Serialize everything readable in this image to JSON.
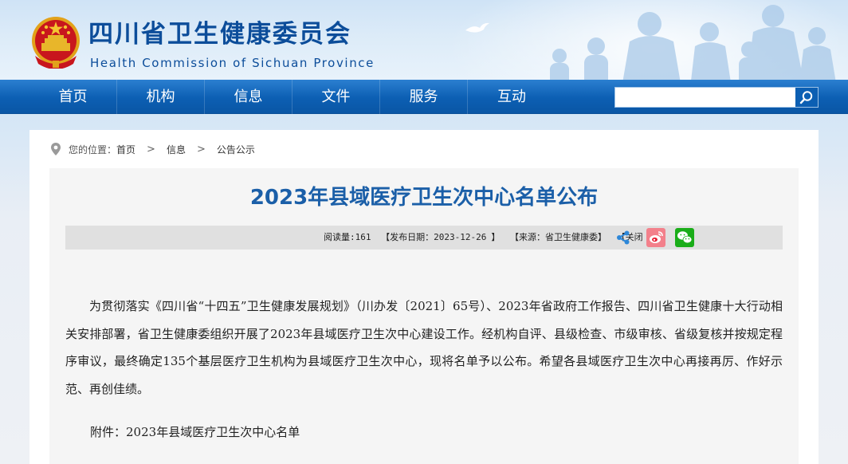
{
  "site": {
    "name_cn": "四川省卫生健康委员会",
    "name_en": "Health Commission of Sichuan Province"
  },
  "nav": {
    "items": [
      {
        "label": "首页"
      },
      {
        "label": "机构"
      },
      {
        "label": "信息"
      },
      {
        "label": "文件"
      },
      {
        "label": "服务"
      },
      {
        "label": "互动"
      }
    ],
    "search": {
      "value": "",
      "placeholder": ""
    }
  },
  "breadcrumb": {
    "prefix": "您的位置：",
    "items": [
      "首页",
      "信息",
      "公告公示"
    ],
    "separator": ">"
  },
  "article": {
    "title": "2023年县域医疗卫生次中心名单公布",
    "meta": {
      "views_label": "阅读量:",
      "views": "161",
      "date_label": "【发布日期：",
      "date": "2023-12-26",
      "date_close": "】",
      "source_label": "【来源：",
      "source": "省卫生健康委",
      "source_close": "】",
      "close_label": "【关闭",
      "close_close": "】"
    },
    "share": {
      "share_icon": "share-icon",
      "weibo_icon": "weibo-icon",
      "wechat_icon": "wechat-icon",
      "weibo_color": "#e6162d",
      "wechat_color": "#1aad19",
      "share_color": "#2d87d8"
    },
    "body": "为贯彻落实《四川省“十四五”卫生健康发展规划》（川办发〔2021〕65号）、2023年省政府工作报告、四川省卫生健康十大行动相关安排部署，省卫生健康委组织开展了2023年县域医疗卫生次中心建设工作。经机构自评、县级检查、市级审核、省级复核并按规定程序审议，最终确定135个基层医疗卫生机构为县域医疗卫生次中心，现将名单予以公布。希望各县域医疗卫生次中心再接再厉、作好示范、再创佳绩。",
    "attachment_label": "附件：",
    "attachment_name": "2023年县域医疗卫生次中心名单"
  },
  "colors": {
    "brand_blue": "#0c4d9a",
    "nav_blue": "#0c5fb3",
    "title_blue": "#1b5fa8"
  }
}
